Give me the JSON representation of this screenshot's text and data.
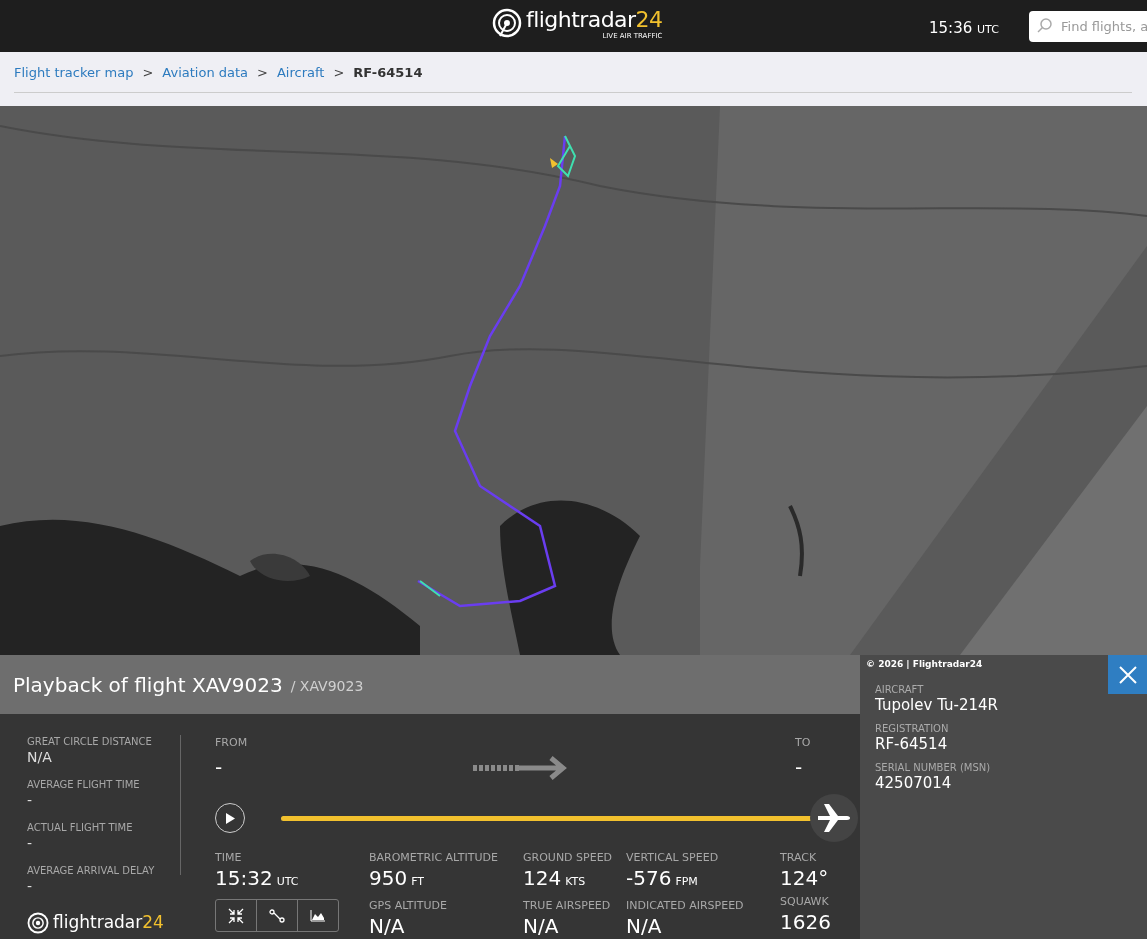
{
  "header": {
    "logo": {
      "name": "flightradar",
      "suffix": "24",
      "tagline": "LIVE AIR TRAFFIC"
    },
    "clock": {
      "time": "15:36",
      "zone": "UTC"
    },
    "search": {
      "placeholder": "Find flights, a"
    }
  },
  "breadcrumb_separator": ">",
  "breadcrumbs": [
    {
      "label": "Flight tracker map",
      "current": false
    },
    {
      "label": "Aviation data",
      "current": false
    },
    {
      "label": "Aircraft",
      "current": false
    },
    {
      "label": "RF-64514",
      "current": true
    }
  ],
  "playback": {
    "title": "Playback of flight XAV9023",
    "subtitle": "/ XAV9023",
    "summary": [
      {
        "label": "GREAT CIRCLE DISTANCE",
        "value": "N/A"
      },
      {
        "label": "AVERAGE FLIGHT TIME",
        "value": "-"
      },
      {
        "label": "ACTUAL FLIGHT TIME",
        "value": "-"
      },
      {
        "label": "AVERAGE ARRIVAL DELAY",
        "value": "-"
      }
    ],
    "footer_logo": {
      "name": "flightradar",
      "suffix": "24"
    },
    "from": {
      "label": "FROM",
      "value": "-"
    },
    "to": {
      "label": "TO",
      "value": "-"
    },
    "progress": {
      "level": 1
    },
    "stats": [
      {
        "label": "TIME",
        "value": "15:32",
        "unit": "UTC"
      },
      {
        "label": "BAROMETRIC ALTITUDE",
        "value": "950",
        "unit": "FT"
      },
      {
        "label": "GROUND SPEED",
        "value": "124",
        "unit": "KTS"
      },
      {
        "label": "VERTICAL SPEED",
        "value": "-576",
        "unit": "FPM"
      },
      {
        "label": "TRACK",
        "value": "124°"
      },
      {
        "label": "GPS ALTITUDE",
        "value": "N/A"
      },
      {
        "label": "TRUE AIRSPEED",
        "value": "N/A"
      },
      {
        "label": "INDICATED AIRSPEED",
        "value": "N/A"
      },
      {
        "label": "SQUAWK",
        "value": "1626"
      }
    ]
  },
  "aircraft_panel": {
    "copyright": "© 2026 | Flightradar24",
    "fields": [
      {
        "label": "AIRCRAFT",
        "value": "Tupolev Tu-214R"
      },
      {
        "label": "REGISTRATION",
        "value": "RF-64514"
      },
      {
        "label": "SERIAL NUMBER (MSN)",
        "value": "42507014"
      }
    ]
  }
}
